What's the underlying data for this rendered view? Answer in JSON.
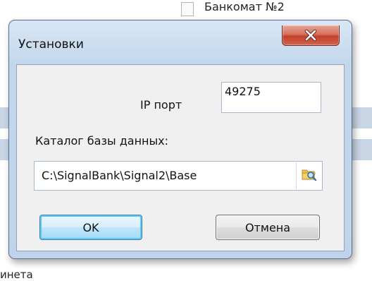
{
  "background": {
    "list_item_text": "Банкомат №2",
    "bottom_text": "инета"
  },
  "dialog": {
    "title": "Установки",
    "ip_port_label": "IP порт",
    "ip_port_value": "49275",
    "catalog_label": "Каталог базы данных:",
    "catalog_path": "C:\\SignalBank\\Signal2\\Base",
    "ok_label": "OK",
    "cancel_label": "Отмена",
    "close_icon": "close-icon",
    "browse_icon": "folder-search-icon"
  },
  "colors": {
    "close_button": "#c94a35",
    "ok_button_border": "#3c7fb1",
    "window_frame": "#c3d7ec"
  }
}
